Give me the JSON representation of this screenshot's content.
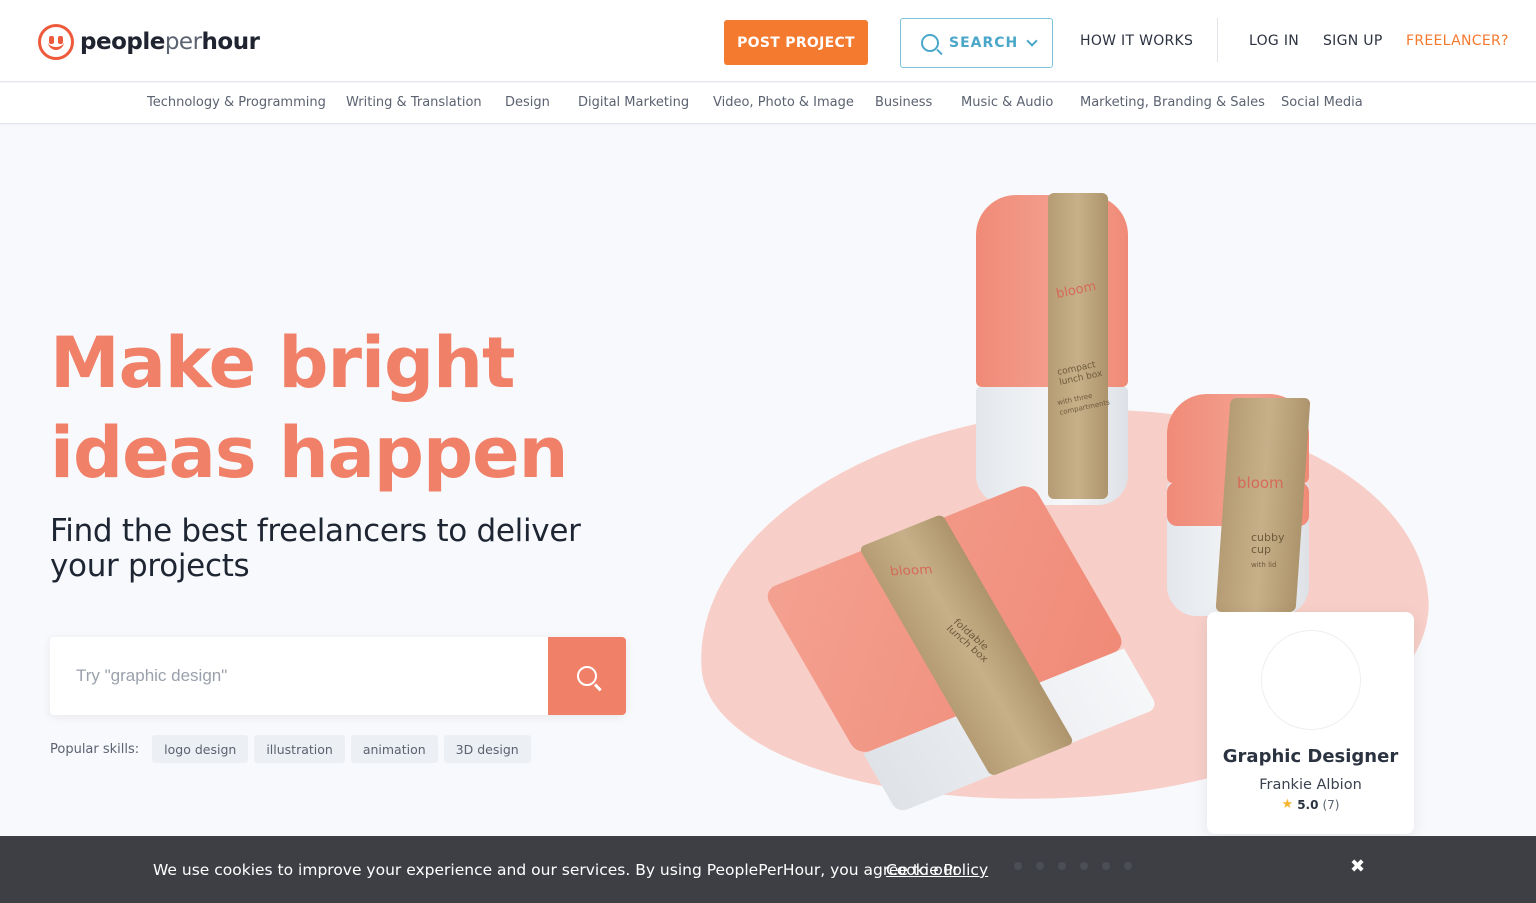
{
  "header": {
    "logo": {
      "part1": "people",
      "part2": "per",
      "part3": "hour"
    },
    "post_project": "POST PROJECT",
    "search": "SEARCH",
    "how_it_works": "HOW IT WORKS",
    "login": "LOG IN",
    "signup": "SIGN UP",
    "freelancer": "FREELANCER?"
  },
  "categories": [
    "Technology & Programming",
    "Writing & Translation",
    "Design",
    "Digital Marketing",
    "Video, Photo & Image",
    "Business",
    "Music & Audio",
    "Marketing, Branding & Sales",
    "Social Media"
  ],
  "hero": {
    "headline_line1": "Make bright",
    "headline_line2": "ideas happen",
    "subhead": "Find the best freelancers to deliver your projects",
    "search_placeholder": "Try \"graphic design\"",
    "popular_label": "Popular skills:",
    "skills": [
      "logo design",
      "illustration",
      "animation",
      "3D design"
    ]
  },
  "illustration": {
    "brand": "bloom",
    "tall_label": "compact lunch box",
    "tall_sub": "with three compartments",
    "cup_label": "cubby cup",
    "cup_sub": "with lid",
    "box_label": "foldable lunch box"
  },
  "featured": {
    "title": "Graphic Designer",
    "name": "Frankie Albion",
    "rating": "5.0",
    "reviews": "(7)"
  },
  "cookie": {
    "text": "We use cookies to improve your experience and our services. By using PeoplePerHour, you agree to our",
    "link": "Cookie Policy",
    "close": "✖"
  },
  "colors": {
    "accent_orange": "#f47a2f",
    "coral": "#f08068",
    "search_blue": "#4aa7c9",
    "cookie_bg": "#3d3f45"
  }
}
